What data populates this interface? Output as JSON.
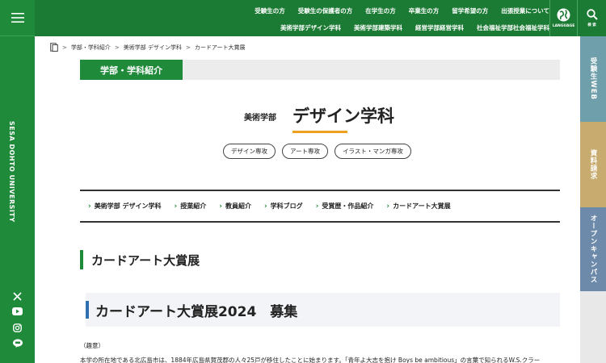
{
  "sidebar": {
    "university_name": "SESA DOHTO UNIVERSITY",
    "social_icons": [
      "x-icon",
      "youtube-icon",
      "instagram-icon",
      "line-icon"
    ]
  },
  "top_nav": {
    "row1": [
      "受験生の方",
      "受験生の保護者の方",
      "在学生の方",
      "卒業生の方",
      "留学希望の方",
      "出張授業について"
    ],
    "row2": [
      "美術学部デザイン学科",
      "美術学部建築学科",
      "経営学部経営学科",
      "社会福祉学部社会福祉学科"
    ],
    "language_label": "LANGUAGE",
    "search_label": "検 索"
  },
  "right_tabs": [
    {
      "label": "受験生WEB",
      "color": "#6f9faa"
    },
    {
      "label": "資料請求",
      "color": "#c8ab6e"
    },
    {
      "label": "オープンキャンパス",
      "color": "#6e8aaa"
    }
  ],
  "breadcrumb": [
    "学部・学科紹介",
    "美術学部 デザイン学科",
    "カードアート大賞展"
  ],
  "section_label": "学部・学科紹介",
  "faculty": "美術学部",
  "department": "デザイン学科",
  "tags": [
    "デザイン専攻",
    "アート専攻",
    "イラスト・マンガ専攻"
  ],
  "subnav": [
    "美術学部 デザイン学科",
    "授業紹介",
    "教員紹介",
    "学科ブログ",
    "受賞歴・作品紹介",
    "カードアート大賞展"
  ],
  "page_heading": "カードアート大賞展",
  "event_heading": "カードアート大賞展2024　募集",
  "intent_label": "（趣意）",
  "body_text": "本学の所在地である北広島市は、1884年広島県賀茂郡の人々25戸が移住したことに始まります。「青年よ大志を抱け Boys be ambitious」の言葉で知られるW.S.クラー",
  "colors": {
    "brand_green": "#1f8a3a",
    "accent_orange": "#f0a020",
    "accent_blue": "#2f6fb0"
  }
}
